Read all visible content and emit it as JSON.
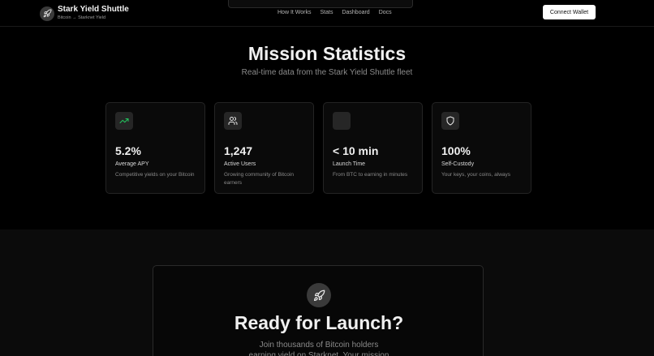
{
  "brand": {
    "title": "Stark Yield Shuttle",
    "subtitle": "Bitcoin → Starknet Yield",
    "logo_icon": "rocket-icon"
  },
  "nav": {
    "links": [
      "How It Works",
      "Stats",
      "Dashboard",
      "Docs"
    ]
  },
  "header": {
    "connect_label": "Connect Wallet"
  },
  "stats": {
    "title": "Mission Statistics",
    "subtitle": "Real-time data from the Stark Yield Shuttle fleet",
    "cards": [
      {
        "icon": "trending-up-icon",
        "value": "5.2%",
        "label": "Average APY",
        "desc": "Competitive yields on your Bitcoin"
      },
      {
        "icon": "users-icon",
        "value": "1,247",
        "label": "Active Users",
        "desc": "Growing community of Bitcoin earners"
      },
      {
        "icon": "clock-icon",
        "value": "< 10 min",
        "label": "Launch Time",
        "desc": "From BTC to earning in minutes"
      },
      {
        "icon": "shield-icon",
        "value": "100%",
        "label": "Self-Custody",
        "desc": "Your keys, your coins, always"
      }
    ]
  },
  "launch": {
    "icon": "rocket-icon",
    "title": "Ready for Launch?",
    "subtitle": "Join thousands of Bitcoin holders earning yield on Starknet. Your mission starts now."
  },
  "colors": {
    "accent_green": "#22c55e",
    "background": "#000000",
    "card_bg": "#0a0a0a"
  }
}
